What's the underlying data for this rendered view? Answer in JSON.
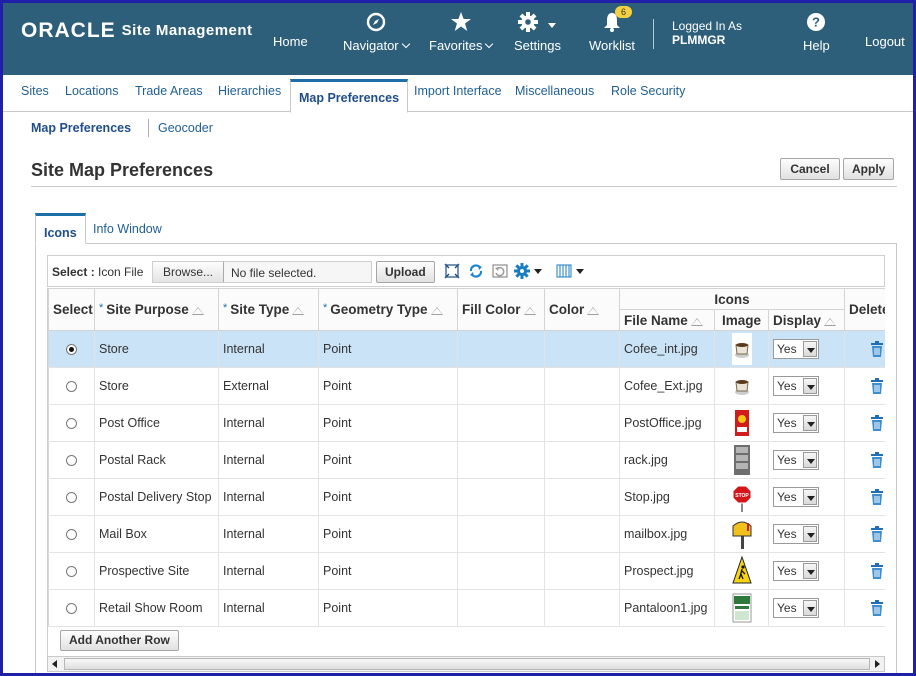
{
  "header": {
    "brand": "ORACLE",
    "app_title": "Site Management",
    "home": "Home",
    "navigator": "Navigator",
    "favorites": "Favorites",
    "settings": "Settings",
    "worklist": "Worklist",
    "worklist_count": "6",
    "logged_in_label": "Logged In As",
    "user": "PLMMGR",
    "help": "Help",
    "logout": "Logout"
  },
  "tabs": [
    "Sites",
    "Locations",
    "Trade Areas",
    "Hierarchies",
    "Map Preferences",
    "Import Interface",
    "Miscellaneous",
    "Role Security"
  ],
  "subtabs": [
    "Map Preferences",
    "Geocoder"
  ],
  "page": {
    "title": "Site Map Preferences",
    "cancel": "Cancel",
    "apply": "Apply"
  },
  "inner_tabs": [
    "Icons",
    "Info Window"
  ],
  "toolbar": {
    "select_label": "Select :",
    "select_value": "Icon File",
    "browse": "Browse...",
    "file_placeholder": "No file selected.",
    "upload": "Upload"
  },
  "columns": {
    "select": "Select",
    "site_purpose": "Site Purpose",
    "site_type": "Site Type",
    "geometry_type": "Geometry Type",
    "fill_color": "Fill Color",
    "color": "Color",
    "icons_group": "Icons",
    "file_name": "File Name",
    "image": "Image",
    "display": "Display",
    "delete": "Delete"
  },
  "rows": [
    {
      "purpose": "Store",
      "type": "Internal",
      "geometry": "Point",
      "file": "Cofee_int.jpg",
      "display": "Yes",
      "icon": "coffee-cup-icon"
    },
    {
      "purpose": "Store",
      "type": "External",
      "geometry": "Point",
      "file": "Cofee_Ext.jpg",
      "display": "Yes",
      "icon": "coffee-cup-icon"
    },
    {
      "purpose": "Post Office",
      "type": "Internal",
      "geometry": "Point",
      "file": "PostOffice.jpg",
      "display": "Yes",
      "icon": "post-office-icon"
    },
    {
      "purpose": "Postal Rack",
      "type": "Internal",
      "geometry": "Point",
      "file": "rack.jpg",
      "display": "Yes",
      "icon": "rack-icon"
    },
    {
      "purpose": "Postal Delivery Stop",
      "type": "Internal",
      "geometry": "Point",
      "file": "Stop.jpg",
      "display": "Yes",
      "icon": "stop-sign-icon"
    },
    {
      "purpose": "Mail Box",
      "type": "Internal",
      "geometry": "Point",
      "file": "mailbox.jpg",
      "display": "Yes",
      "icon": "mailbox-icon"
    },
    {
      "purpose": "Prospective Site",
      "type": "Internal",
      "geometry": "Point",
      "file": "Prospect.jpg",
      "display": "Yes",
      "icon": "construction-sign-icon"
    },
    {
      "purpose": "Retail Show Room",
      "type": "Internal",
      "geometry": "Point",
      "file": "Pantaloon1.jpg",
      "display": "Yes",
      "icon": "storefront-icon"
    }
  ],
  "add_row": "Add Another Row"
}
